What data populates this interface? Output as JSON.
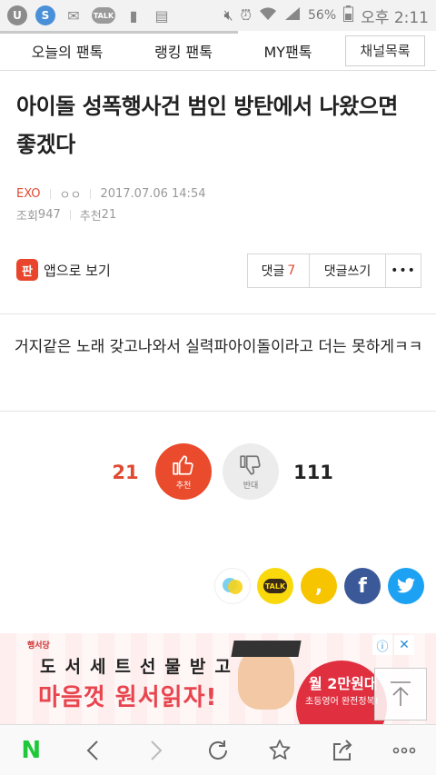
{
  "status_bar": {
    "icons": [
      "u-icon",
      "s-icon",
      "mail-icon",
      "talk-icon",
      "sim-icon",
      "clipboard-icon",
      "mute-icon",
      "alarm-icon",
      "wifi-icon",
      "signal-icon"
    ],
    "battery": "56%",
    "time": "오후 2:11"
  },
  "tabs": {
    "today": "오늘의 팬톡",
    "ranking": "랭킹 팬톡",
    "my": "MY팬톡",
    "channel_list": "채널목록"
  },
  "post": {
    "title": "아이돌 성폭행사건 범인 방탄에서 나왔으면 좋겠다",
    "board": "EXO",
    "author": "ㅇㅇ",
    "date": "2017.07.06 14:54",
    "views_label": "조회",
    "views": "947",
    "recommend_label": "추천",
    "recommend": "21",
    "body": "거지같은 노래 갖고나와서 실력파아이돌이라고 더는 못하게ㅋㅋ"
  },
  "actions": {
    "app_icon_text": "판",
    "app_view": "앱으로 보기",
    "comments_label": "댓글",
    "comments_count": "7",
    "write_comment": "댓글쓰기",
    "more": "•••"
  },
  "votes": {
    "up_count": "21",
    "up_label": "추천",
    "down_label": "반대",
    "down_count": "111"
  },
  "share": {
    "kakaostory": "kakaostory-icon",
    "kakaotalk_text": "TALK",
    "kakaopage_text": ",",
    "facebook_text": "f",
    "twitter": "twitter-icon"
  },
  "ad": {
    "brand": "행서당",
    "line1": "도서세트선물받고",
    "line2": "마음껏 원서읽자!",
    "circle1": "월 2만원대",
    "circle2": "초등영어 완전정복!",
    "info": "ⓘ",
    "close": "✕"
  },
  "toolbar": {
    "home": "N"
  },
  "colors": {
    "accent": "#e04a32",
    "vote_up": "#ea4b2c",
    "naver_green": "#1fc83a"
  }
}
